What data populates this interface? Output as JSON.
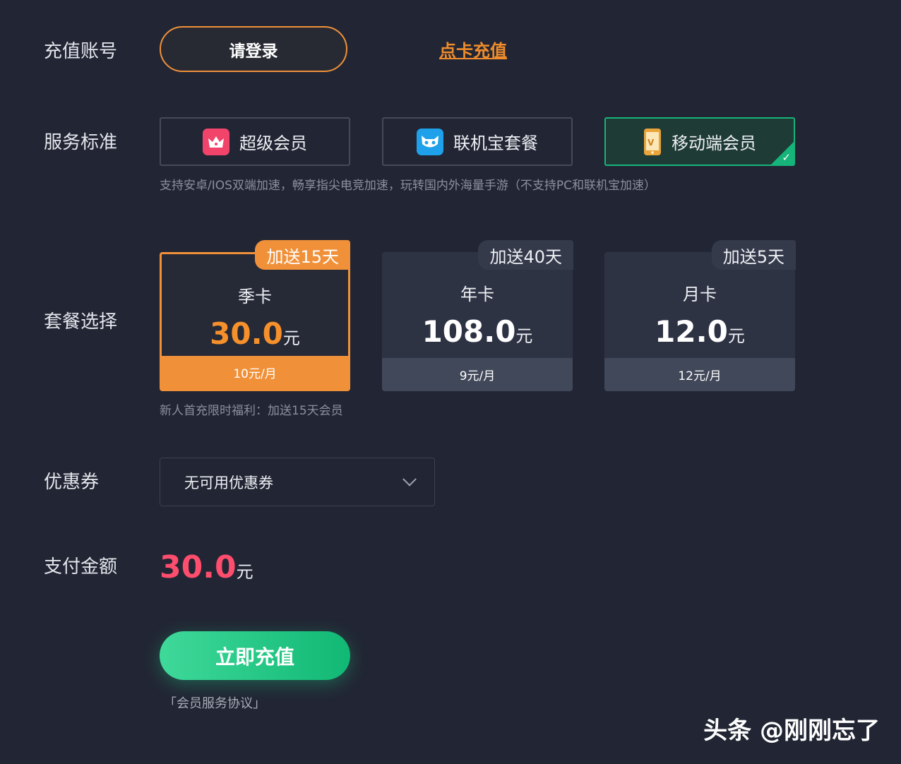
{
  "rows": {
    "account": "充值账号",
    "service": "服务标准",
    "plan": "套餐选择",
    "coupon": "优惠券",
    "amount": "支付金额"
  },
  "account": {
    "login_label": "请登录",
    "card_link": "点卡充值"
  },
  "services": [
    {
      "label": "超级会员",
      "icon": "crown-icon",
      "selected": false
    },
    {
      "label": "联机宝套餐",
      "icon": "mascot-icon",
      "selected": false
    },
    {
      "label": "移动端会员",
      "icon": "phone-vip-icon",
      "selected": true
    }
  ],
  "service_hint": "支持安卓/IOS双端加速，畅享指尖电竞加速，玩转国内外海量手游（不支持PC和联机宝加速）",
  "plans": [
    {
      "badge": "加送15天",
      "name": "季卡",
      "price": "30.0",
      "unit": "元",
      "monthly": "10元/月",
      "selected": true
    },
    {
      "badge": "加送40天",
      "name": "年卡",
      "price": "108.0",
      "unit": "元",
      "monthly": "9元/月",
      "selected": false
    },
    {
      "badge": "加送5天",
      "name": "月卡",
      "price": "12.0",
      "unit": "元",
      "monthly": "12元/月",
      "selected": false
    }
  ],
  "plan_hint": "新人首充限时福利：加送15天会员",
  "coupon": {
    "value": "无可用优惠券"
  },
  "amount": {
    "value": "30.0",
    "unit": "元"
  },
  "pay_label": "立即充值",
  "agreement": "「会员服务协议」",
  "watermark": "头条 @刚刚忘了",
  "colors": {
    "background": "#222634",
    "accent_orange": "#f0913a",
    "accent_green": "#16b47a",
    "amount_red": "#ff4d6d"
  }
}
